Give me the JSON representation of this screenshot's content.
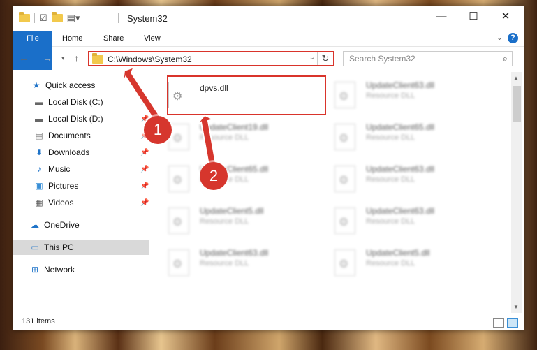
{
  "window": {
    "title": "System32",
    "controls": {
      "minimize": "—",
      "maximize": "☐",
      "close": "✕"
    }
  },
  "ribbon": {
    "tabs": [
      "File",
      "Home",
      "Share",
      "View"
    ],
    "help": "?"
  },
  "nav": {
    "address": "C:\\Windows\\System32",
    "search_placeholder": "Search System32"
  },
  "sidebar": {
    "items": [
      {
        "label": "Quick access",
        "icon": "star-icon"
      },
      {
        "label": "Local Disk (C:)",
        "icon": "drive-icon"
      },
      {
        "label": "Local Disk (D:)",
        "icon": "drive-icon"
      },
      {
        "label": "Documents",
        "icon": "documents-icon"
      },
      {
        "label": "Downloads",
        "icon": "download-icon"
      },
      {
        "label": "Music",
        "icon": "music-icon"
      },
      {
        "label": "Pictures",
        "icon": "pictures-icon"
      },
      {
        "label": "Videos",
        "icon": "videos-icon"
      },
      {
        "label": "OneDrive",
        "icon": "cloud-icon"
      },
      {
        "label": "This PC",
        "icon": "computer-icon",
        "selected": true
      },
      {
        "label": "Network",
        "icon": "network-icon"
      }
    ]
  },
  "files": {
    "highlighted": {
      "name": "dpvs.dll"
    },
    "col1": [
      {
        "name": "UpdateClient19.dll",
        "type": "Resource DLL"
      },
      {
        "name": "UpdateClient65.dll",
        "type": "Resource DLL"
      },
      {
        "name": "UpdateClient5.dll",
        "type": "Resource DLL"
      },
      {
        "name": "UpdateClient63.dll",
        "type": "Resource DLL"
      }
    ],
    "col2": [
      {
        "name": "UpdateClient63.dll",
        "type": "Resource DLL"
      },
      {
        "name": "UpdateClient65.dll",
        "type": "Resource DLL"
      },
      {
        "name": "UpdateClient63.dll",
        "type": "Resource DLL"
      },
      {
        "name": "UpdateClient63.dll",
        "type": "Resource DLL"
      },
      {
        "name": "UpdateClient5.dll",
        "type": "Resource DLL"
      }
    ]
  },
  "annotations": {
    "step1": "1",
    "step2": "2",
    "color": "#d6362d"
  },
  "status": {
    "items": "131 items"
  }
}
